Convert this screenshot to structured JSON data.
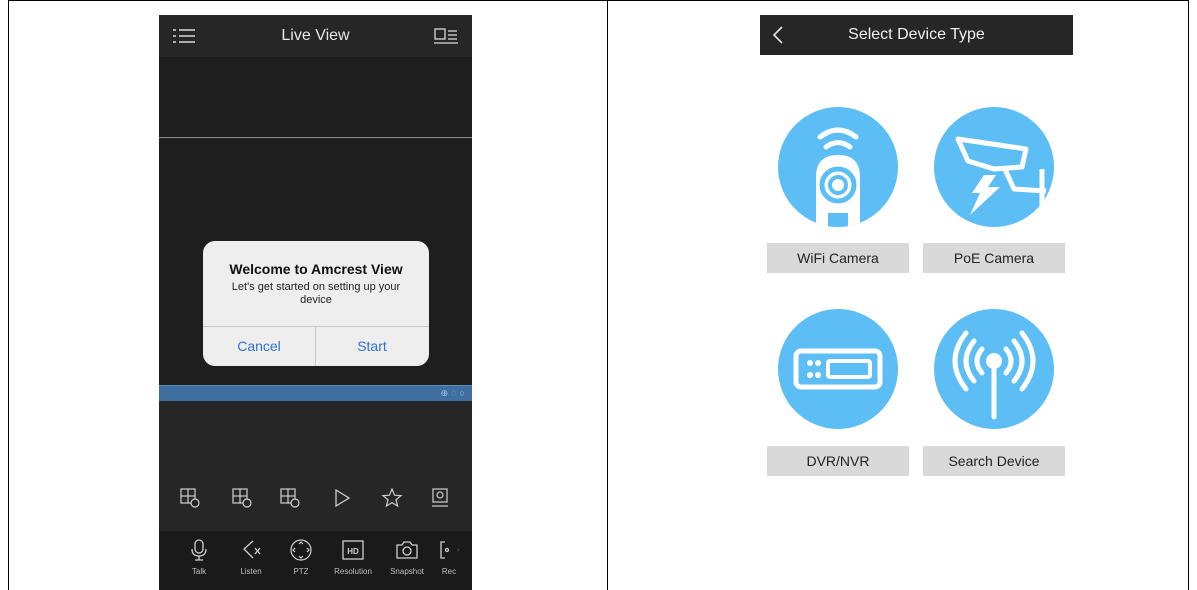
{
  "live_view": {
    "title": "Live View",
    "dialog": {
      "title": "Welcome to Amcrest View",
      "message": "Let's get started on setting up your device",
      "cancel_label": "Cancel",
      "start_label": "Start"
    },
    "bottom_bar": [
      {
        "icon": "microphone-icon",
        "label": "Talk"
      },
      {
        "icon": "speaker-mute-icon",
        "label": "Listen"
      },
      {
        "icon": "ptz-icon",
        "label": "PTZ"
      },
      {
        "icon": "hd-icon",
        "label": "Resolution"
      },
      {
        "icon": "camera-icon",
        "label": "Snapshot"
      },
      {
        "icon": "record-icon",
        "label": "Rec"
      }
    ],
    "hd_badge": "HD"
  },
  "select_device": {
    "title": "Select Device Type",
    "devices": [
      {
        "icon": "wifi-camera-icon",
        "label": "WiFi Camera"
      },
      {
        "icon": "poe-camera-icon",
        "label": "PoE Camera"
      },
      {
        "icon": "dvr-nvr-icon",
        "label": "DVR/NVR"
      },
      {
        "icon": "search-device-icon",
        "label": "Search Device"
      }
    ]
  },
  "colors": {
    "accent_blue": "#5cbef4",
    "dialog_button": "#2f73d9",
    "selection_bar": "#3e6f9e",
    "dark_bg": "#262626"
  }
}
